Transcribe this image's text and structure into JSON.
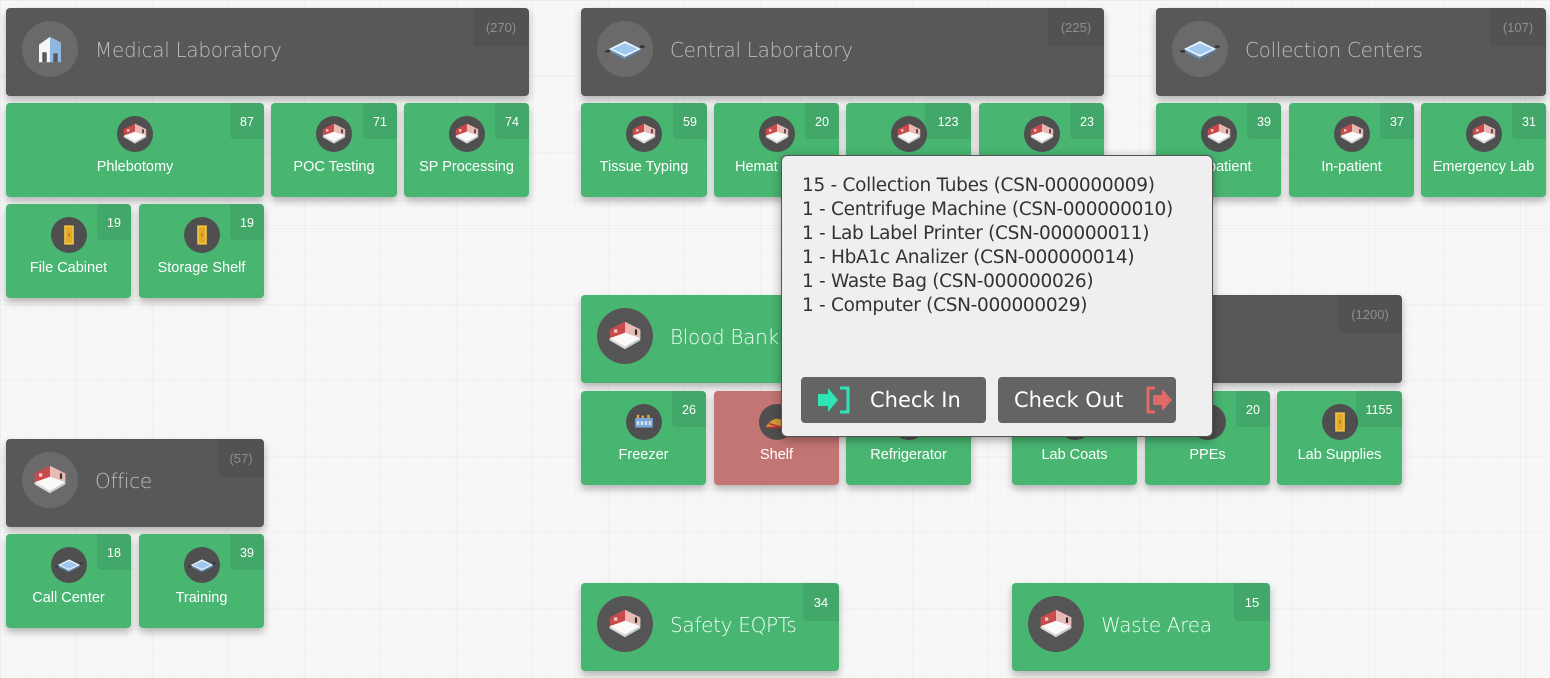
{
  "colors": {
    "group_header": "#585858",
    "tile_green": "#48b571",
    "tile_alert": "#c37573",
    "popup_bg": "#efefef",
    "checkin_accent": "#2ee6b5",
    "checkout_accent": "#e06b66"
  },
  "groups": [
    {
      "id": "medical-laboratory",
      "title": "Medical Laboratory",
      "count": "(270)",
      "icon": "building-icon",
      "children": [
        {
          "label": "Phlebotomy",
          "count": "87",
          "icon": "room-icon"
        },
        {
          "label": "POC Testing",
          "count": "71",
          "icon": "room-icon"
        },
        {
          "label": "SP Processing",
          "count": "74",
          "icon": "room-icon"
        },
        {
          "label": "File Cabinet",
          "count": "19",
          "icon": "cabinet-icon"
        },
        {
          "label": "Storage Shelf",
          "count": "19",
          "icon": "cabinet-icon"
        }
      ]
    },
    {
      "id": "central-laboratory",
      "title": "Central Laboratory",
      "count": "(225)",
      "icon": "floor-icon",
      "children": [
        {
          "label": "Tissue Typing",
          "count": "59",
          "icon": "room-icon"
        },
        {
          "label": "Hemat",
          "count": "20",
          "icon": "room-icon"
        },
        {
          "label": "",
          "count": "123",
          "icon": "room-icon"
        },
        {
          "label": "",
          "count": "23",
          "icon": "room-icon"
        }
      ]
    },
    {
      "id": "collection-centers",
      "title": "Collection Centers",
      "count": "(107)",
      "icon": "floor-icon",
      "children": [
        {
          "label": "patient",
          "count": "39",
          "icon": "room-icon"
        },
        {
          "label": "In-patient",
          "count": "37",
          "icon": "room-icon"
        },
        {
          "label": "Emergency Lab",
          "count": "31",
          "icon": "room-icon"
        }
      ]
    },
    {
      "id": "office",
      "title": "Office",
      "count": "(57)",
      "icon": "room-icon",
      "children": [
        {
          "label": "Call Center",
          "count": "18",
          "icon": "floor-icon"
        },
        {
          "label": "Training",
          "count": "39",
          "icon": "floor-icon"
        }
      ]
    },
    {
      "id": "blood-bank",
      "title": "Blood Bank",
      "count": "",
      "icon": "room-icon",
      "children": [
        {
          "label": "Freezer",
          "count": "26",
          "icon": "freezer-icon"
        },
        {
          "label": "Shelf",
          "count": "",
          "icon": "shelf-icon",
          "state": "alert"
        },
        {
          "label": "Refrigerator",
          "count": "",
          "icon": "fridge-icon"
        }
      ]
    },
    {
      "id": "storage",
      "title": "",
      "count": "(1200)",
      "icon": "",
      "children": [
        {
          "label": "Lab Coats",
          "count": "",
          "icon": "cabinet-icon"
        },
        {
          "label": "PPEs",
          "count": "20",
          "icon": "cabinet-icon"
        },
        {
          "label": "Lab Supplies",
          "count": "1155",
          "icon": "cabinet-icon"
        }
      ]
    },
    {
      "id": "safety-eqpts",
      "title": "Safety EQPTs",
      "count": "34",
      "icon": "room-icon"
    },
    {
      "id": "waste-area",
      "title": "Waste Area",
      "count": "15",
      "icon": "room-icon"
    }
  ],
  "popup": {
    "items": [
      "15 - Collection Tubes (CSN-000000009)",
      "1 - Centrifuge Machine (CSN-000000010)",
      "1 - Lab Label Printer (CSN-000000011)",
      "1 - HbA1c Analizer (CSN-000000014)",
      "1 - Waste Bag (CSN-000000026)",
      "1 - Computer (CSN-000000029)"
    ],
    "check_in_label": "Check In",
    "check_out_label": "Check Out"
  }
}
